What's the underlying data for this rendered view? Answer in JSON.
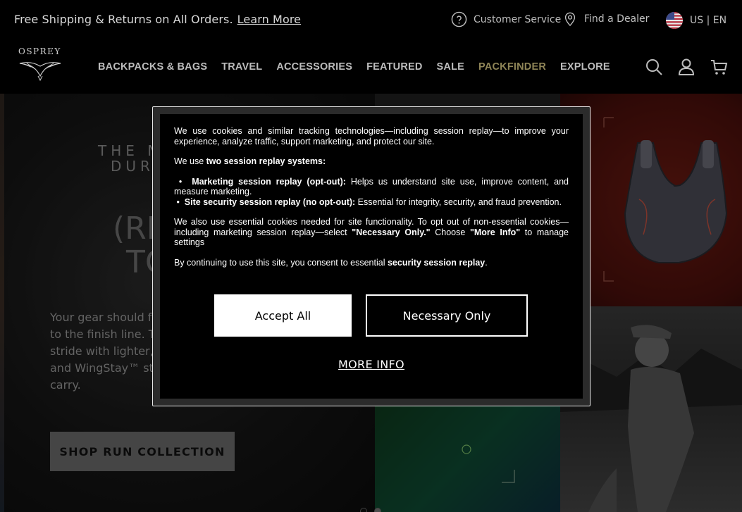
{
  "utility_bar": {
    "promo_text": "Free Shipping & Returns on All Orders.",
    "promo_link": "Learn More",
    "customer_service": "Customer Service",
    "find_dealer": "Find a Dealer",
    "locale": "US | EN"
  },
  "nav": {
    "logo_text": "OSPREY",
    "links": [
      "BACKPACKS & BAGS",
      "TRAVEL",
      "ACCESSORIES",
      "FEATURED",
      "SALE",
      "PACKFINDER",
      "EXPLORE"
    ],
    "accent_color": "#8f8557"
  },
  "hero": {
    "eyebrow_line1": "THE N",
    "eyebrow_line2": "DUR",
    "heading_line1": "(RE",
    "heading_line2": "TO",
    "body_lines": [
      "Your gear should fe",
      "to the finish line. Th",
      "stride with lighter, s",
      "and WingStay™ sta",
      "carry."
    ],
    "cta": "SHOP RUN COLLECTION"
  },
  "cookie_modal": {
    "intro": "We use cookies and similar tracking technologies—including session replay—to improve your experience, analyze traffic, support marketing, and protect our site.",
    "we_use_prefix": "We use ",
    "we_use_bold": "two session replay systems:",
    "bullet1_bold": "Marketing session replay (opt-out):",
    "bullet1_text": " Helps us understand site use, improve content, and measure marketing.",
    "bullet2_bold": "Site security session replay (no opt-out):",
    "bullet2_text": " Essential for integrity, security, and fraud prevention.",
    "essential_a": "We also use essential cookies needed for site functionality. To opt out of non-essential cookies—including marketing session replay—select ",
    "essential_bold1": "\"Necessary Only.\"",
    "essential_b": " Choose ",
    "essential_bold2": "\"More Info\"",
    "essential_c": " to manage settings",
    "consent_a": "By continuing to use this site, you consent to essential ",
    "consent_bold": "security session replay",
    "consent_c": ".",
    "accept_all": "Accept All",
    "necessary_only": "Necessary Only",
    "more_info": "MORE INFO"
  }
}
